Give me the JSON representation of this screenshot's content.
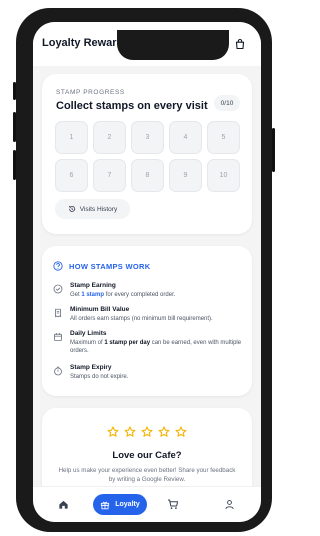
{
  "header": {
    "title": "Loyalty Rewards",
    "icons": [
      "info-icon",
      "shopping-bag-icon"
    ]
  },
  "stamps": {
    "eyebrow": "STAMP PROGRESS",
    "title": "Collect stamps on every visit",
    "count": "0/10",
    "cells": [
      "1",
      "2",
      "3",
      "4",
      "5",
      "6",
      "7",
      "8",
      "9",
      "10"
    ],
    "history_label": "Visits History"
  },
  "how": {
    "title": "HOW STAMPS WORK",
    "earning": {
      "title": "Stamp Earning",
      "desc_pre": "Get ",
      "desc_em": "1 stamp",
      "desc_post": " for every completed order."
    },
    "min_bill": {
      "title": "Minimum Bill Value",
      "desc": "All orders earn stamps (no minimum bill requirement)."
    },
    "daily": {
      "title": "Daily Limits",
      "desc_pre": "Maximum of ",
      "desc_em": "1 stamp per day",
      "desc_post": " can be earned, even with multiple orders."
    },
    "expiry": {
      "title": "Stamp Expiry",
      "desc": "Stamps do not expire."
    }
  },
  "review": {
    "star_count": 5,
    "title": "Love our Cafe?",
    "desc": "Help us make your experience even better! Share your feedback by writing a Google Review."
  },
  "nav": {
    "active_label": "Loyalty",
    "items": [
      "home-icon",
      "gift-icon",
      "cart-icon",
      "user-icon"
    ]
  },
  "colors": {
    "accent": "#2563eb",
    "star": "#f5b301",
    "card": "#ffffff",
    "screen_bg": "#f4f4f5"
  }
}
